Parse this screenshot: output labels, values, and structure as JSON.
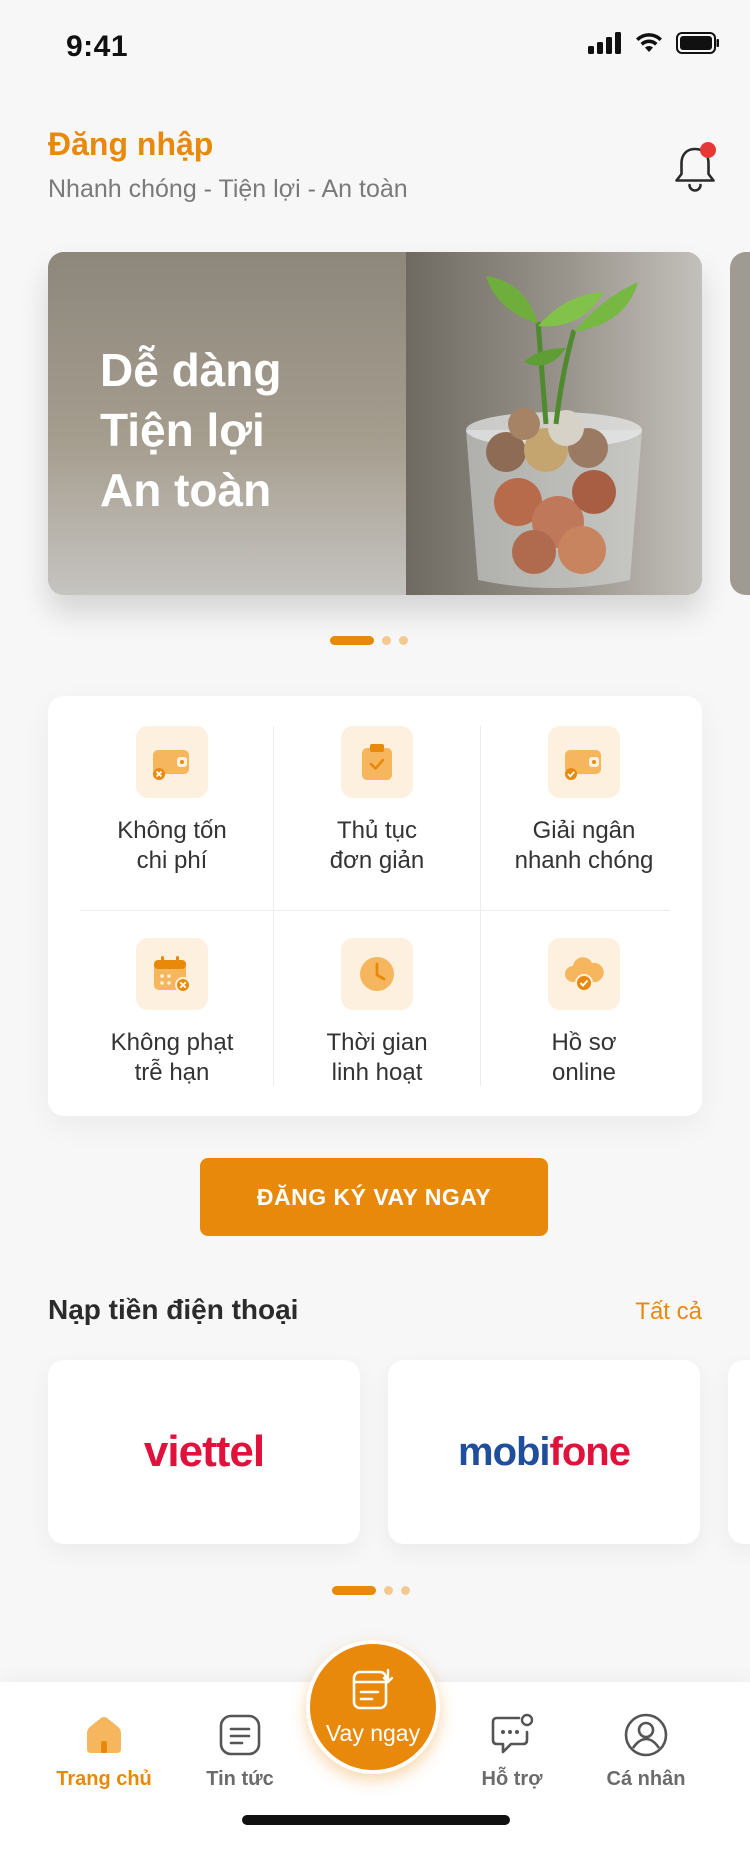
{
  "status_bar": {
    "time": "9:41"
  },
  "header": {
    "title": "Đăng nhập",
    "subtitle": "Nhanh chóng - Tiện lợi - An toàn"
  },
  "banner": {
    "lines": [
      "Dễ dàng",
      "Tiện lợi",
      "An toàn"
    ],
    "page_count": 3,
    "active_page": 1
  },
  "features": [
    {
      "label": "Không tốn\nchi phí",
      "icon": "wallet-x-icon"
    },
    {
      "label": "Thủ tục\nđơn giản",
      "icon": "clipboard-check-icon"
    },
    {
      "label": "Giải ngân\nnhanh chóng",
      "icon": "wallet-check-icon"
    },
    {
      "label": "Không phạt\ntrễ hạn",
      "icon": "calendar-x-icon"
    },
    {
      "label": "Thời gian\nlinh hoạt",
      "icon": "clock-icon"
    },
    {
      "label": "Hồ sơ\nonline",
      "icon": "cloud-check-icon"
    }
  ],
  "cta": {
    "label": "ĐĂNG KÝ VAY NGAY"
  },
  "topup": {
    "title": "Nạp tiền điện thoại",
    "see_all": "Tất cả",
    "carriers": [
      {
        "name": "viettel"
      },
      {
        "name_part1": "mobi",
        "name_part2": "fone"
      }
    ],
    "page_count": 3,
    "active_page": 1
  },
  "bottom_nav": {
    "items": [
      {
        "label": "Trang chủ",
        "icon": "home-icon",
        "active": true
      },
      {
        "label": "Tin tức",
        "icon": "news-icon",
        "active": false
      },
      {
        "label": "Hỗ trợ",
        "icon": "chat-support-icon",
        "active": false
      },
      {
        "label": "Cá nhân",
        "icon": "profile-icon",
        "active": false
      }
    ],
    "center_action": {
      "label": "Vay ngay",
      "icon": "loan-form-icon"
    }
  },
  "colors": {
    "accent": "#e8890c",
    "accent_light": "#fdf0de",
    "notification": "#e53935",
    "viettel_red": "#e0123c",
    "mobifone_blue": "#1f4e9c"
  }
}
